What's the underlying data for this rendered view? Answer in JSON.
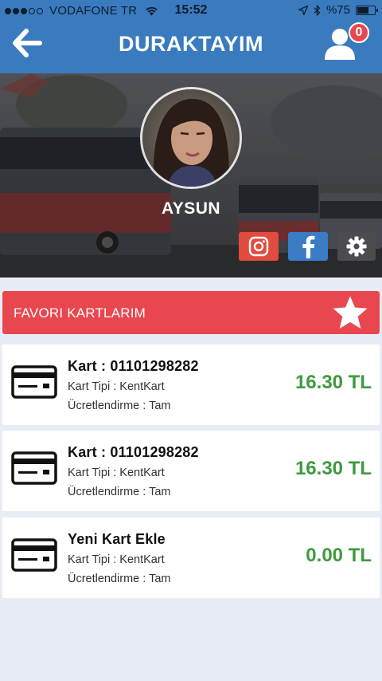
{
  "status_bar": {
    "carrier": "VODAFONE TR",
    "time": "15:52",
    "battery_text": "%75",
    "battery_level": 0.75,
    "signal_bars": 3
  },
  "nav": {
    "title": "DURAKTAYIM",
    "notification_count": "0"
  },
  "profile": {
    "name": "AYSUN"
  },
  "social": {
    "instagram_icon": "instagram-icon",
    "facebook_icon": "facebook-icon",
    "settings_icon": "gear-icon"
  },
  "favorites": {
    "title": "FAVORI KARTLARIM"
  },
  "cards": [
    {
      "title": "Kart : 01101298282",
      "type": "Kart Tipi : KentKart",
      "billing": "Ücretlendirme : Tam",
      "balance": "16.30 TL"
    },
    {
      "title": "Kart : 01101298282",
      "type": "Kart Tipi : KentKart",
      "billing": "Ücretlendirme : Tam",
      "balance": "16.30 TL"
    },
    {
      "title": "Yeni Kart Ekle",
      "type": "Kart Tipi : KentKart",
      "billing": "Ücretlendirme : Tam",
      "balance": "0.00 TL"
    }
  ],
  "colors": {
    "nav_blue": "#3a7bbf",
    "favorites_red": "#e9474f",
    "balance_green": "#3f9a3f",
    "badge_red": "#e8474f"
  }
}
